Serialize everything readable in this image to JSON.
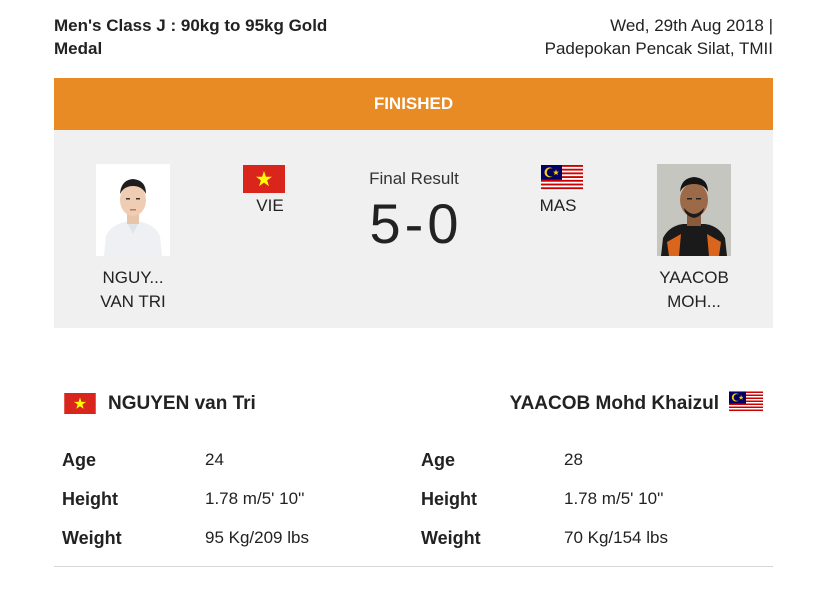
{
  "event": {
    "title": "Men's Class J : 90kg to 95kg Gold Medal",
    "date": "Wed, 29th Aug 2018 |",
    "venue": "Padepokan Pencak Silat, TMII"
  },
  "status": "FINISHED",
  "result": {
    "label": "Final Result",
    "score_left": "5",
    "score_separator": "-",
    "score_right": "0"
  },
  "athletes": {
    "left": {
      "short_name_line1": "NGUY...",
      "short_name_line2": "VAN TRI",
      "country_code": "VIE",
      "full_name": "NGUYEN van Tri",
      "flag": "vietnam-flag",
      "bio": [
        {
          "label": "Age",
          "value": "24"
        },
        {
          "label": "Height",
          "value": "1.78 m/5' 10''"
        },
        {
          "label": "Weight",
          "value": "95 Kg/209 lbs"
        }
      ]
    },
    "right": {
      "short_name_line1": "YAACOB",
      "short_name_line2": "MOH...",
      "country_code": "MAS",
      "full_name": "YAACOB Mohd Khaizul",
      "flag": "malaysia-flag",
      "bio": [
        {
          "label": "Age",
          "value": "28"
        },
        {
          "label": "Height",
          "value": "1.78 m/5' 10''"
        },
        {
          "label": "Weight",
          "value": "70 Kg/154 lbs"
        }
      ]
    }
  },
  "colors": {
    "status_bar": "#e88b25",
    "panel_bg": "#f0f0f0",
    "vietnam_red": "#da251d",
    "vietnam_star": "#ffff00",
    "malaysia_blue": "#010066",
    "malaysia_red": "#cc0001",
    "malaysia_yellow": "#ffcc00"
  }
}
